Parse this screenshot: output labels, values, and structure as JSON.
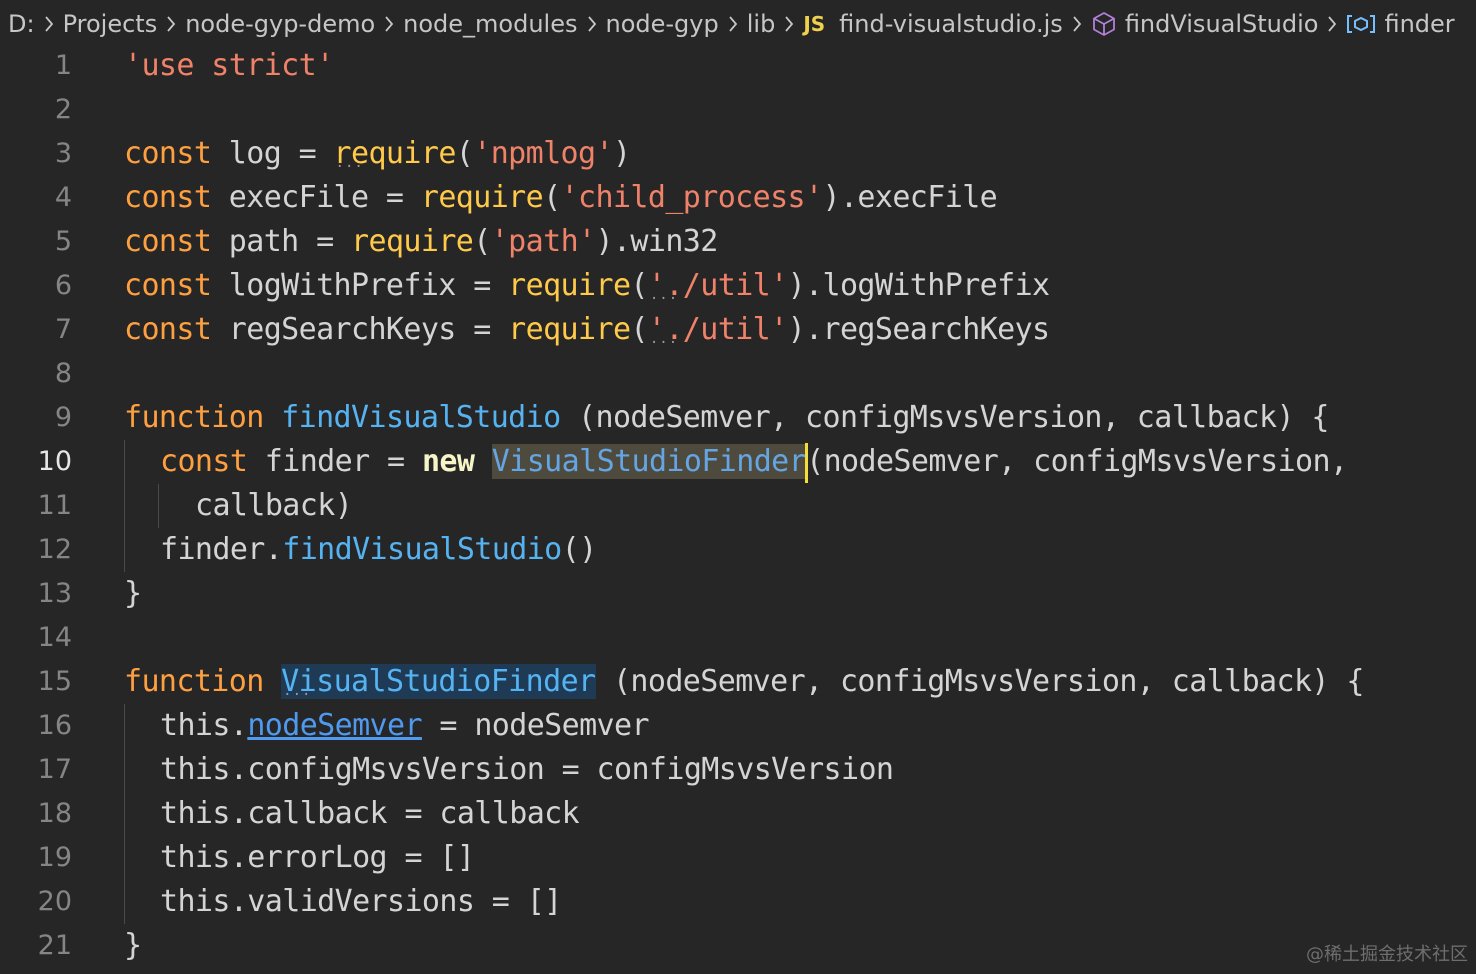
{
  "breadcrumb": {
    "items": [
      {
        "label": "D:"
      },
      {
        "label": "Projects"
      },
      {
        "label": "node-gyp-demo"
      },
      {
        "label": "node_modules"
      },
      {
        "label": "node-gyp"
      },
      {
        "label": "lib"
      },
      {
        "label": "find-visualstudio.js",
        "badge": "JS"
      },
      {
        "label": "findVisualStudio",
        "icon": "cube-icon"
      },
      {
        "label": "finder",
        "icon": "variable-icon"
      }
    ]
  },
  "colors": {
    "background": "#262626",
    "keyword": "#ffa040",
    "function_call": "#ffc94a",
    "string": "#f0826a",
    "function_decl": "#56b3f2",
    "cursor": "#f2dd3a"
  },
  "editor": {
    "active_line": 10,
    "lines": [
      {
        "num": "1"
      },
      {
        "num": "2"
      },
      {
        "num": "3"
      },
      {
        "num": "4"
      },
      {
        "num": "5"
      },
      {
        "num": "6"
      },
      {
        "num": "7"
      },
      {
        "num": "8"
      },
      {
        "num": "9"
      },
      {
        "num": "10"
      },
      {
        "num": "11"
      },
      {
        "num": "12"
      },
      {
        "num": "13"
      },
      {
        "num": "14"
      },
      {
        "num": "15"
      },
      {
        "num": "16"
      },
      {
        "num": "17"
      },
      {
        "num": "18"
      },
      {
        "num": "19"
      },
      {
        "num": "20"
      },
      {
        "num": "21"
      }
    ],
    "tokens": {
      "l1_str": "'use strict'",
      "l3_kw": "const",
      "l3_id": " log = ",
      "l3_fn": "require",
      "l3_p1": "(",
      "l3_str": "'npmlog'",
      "l3_p2": ")",
      "l4_kw": "const",
      "l4_id": " execFile = ",
      "l4_fn": "require",
      "l4_p1": "(",
      "l4_str": "'child_process'",
      "l4_p2": ").execFile",
      "l5_kw": "const",
      "l5_id": " path = ",
      "l5_fn": "require",
      "l5_p1": "(",
      "l5_str": "'path'",
      "l5_p2": ").win32",
      "l6_kw": "const",
      "l6_id": " logWithPrefix = ",
      "l6_fn": "require",
      "l6_p1": "(",
      "l6_str_q": "'",
      "l6_str": "./util'",
      "l6_p2": ").logWithPrefix",
      "l7_kw": "const",
      "l7_id": " regSearchKeys = ",
      "l7_fn": "require",
      "l7_p1": "(",
      "l7_str_q": "'",
      "l7_str": "./util'",
      "l7_p2": ").regSearchKeys",
      "l9_kw": "function",
      "l9_sp": " ",
      "l9_fn": "findVisualStudio",
      "l9_rest": " (nodeSemver, configMsvsVersion, callback) {",
      "l10_kw": "const",
      "l10_id": " finder = ",
      "l10_new": "new",
      "l10_sp": " ",
      "l10_hl": "VisualStudioFinder",
      "l10_rest": "(nodeSemver, configMsvsVersion,",
      "l11_rest": "callback)",
      "l12_id": "finder.",
      "l12_fn": "findVisualStudio",
      "l12_rest": "()",
      "l13_rest": "}",
      "l15_kw": "function",
      "l15_sp": " ",
      "l15_hl_first": "V",
      "l15_hl": "isualStudioFinder",
      "l15_rest": " (nodeSemver, configMsvsVersion, callback) {",
      "l16_this": "this.",
      "l16_link": "nodeSemver",
      "l16_rest": " = nodeSemver",
      "l17_rest": "this.configMsvsVersion = configMsvsVersion",
      "l18_rest": "this.callback = callback",
      "l19_rest": "this.errorLog = []",
      "l20_rest": "this.validVersions = []",
      "l21_rest": "}"
    }
  },
  "watermark": "@稀土掘金技术社区"
}
